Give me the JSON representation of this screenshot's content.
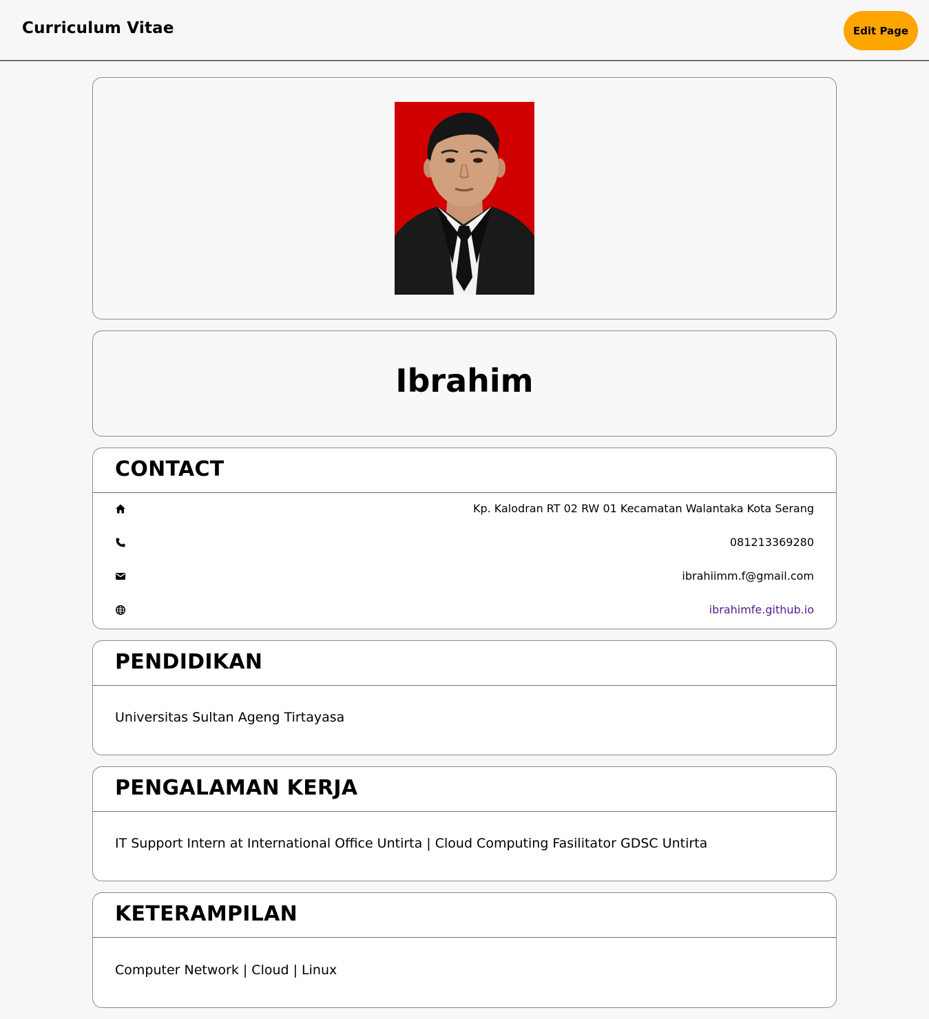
{
  "header": {
    "title": "Curriculum Vitae",
    "edit_button": "Edit Page"
  },
  "profile": {
    "photo_alt": "Profile photo",
    "name": "Ibrahim"
  },
  "contact": {
    "title": "CONTACT",
    "items": [
      {
        "icon": "home-icon",
        "value": "Kp. Kalodran RT 02 RW 01 Kecamatan Walantaka Kota Serang"
      },
      {
        "icon": "phone-icon",
        "value": "081213369280"
      },
      {
        "icon": "mail-icon",
        "value": "ibrahiimm.f@gmail.com"
      },
      {
        "icon": "globe-icon",
        "value": "ibrahimfe.github.io"
      }
    ]
  },
  "education": {
    "title": "PENDIDIKAN",
    "content": "Universitas Sultan Ageng Tirtayasa"
  },
  "experience": {
    "title": "PENGALAMAN KERJA",
    "content": "IT Support Intern at International Office Untirta | Cloud Computing Fasilitator GDSC Untirta"
  },
  "skills": {
    "title": "KETERAMPILAN",
    "content": "Computer Network | Cloud | Linux"
  },
  "colors": {
    "accent_button": "#ffa500",
    "link": "#551a8b",
    "photo_background": "#d00000"
  }
}
